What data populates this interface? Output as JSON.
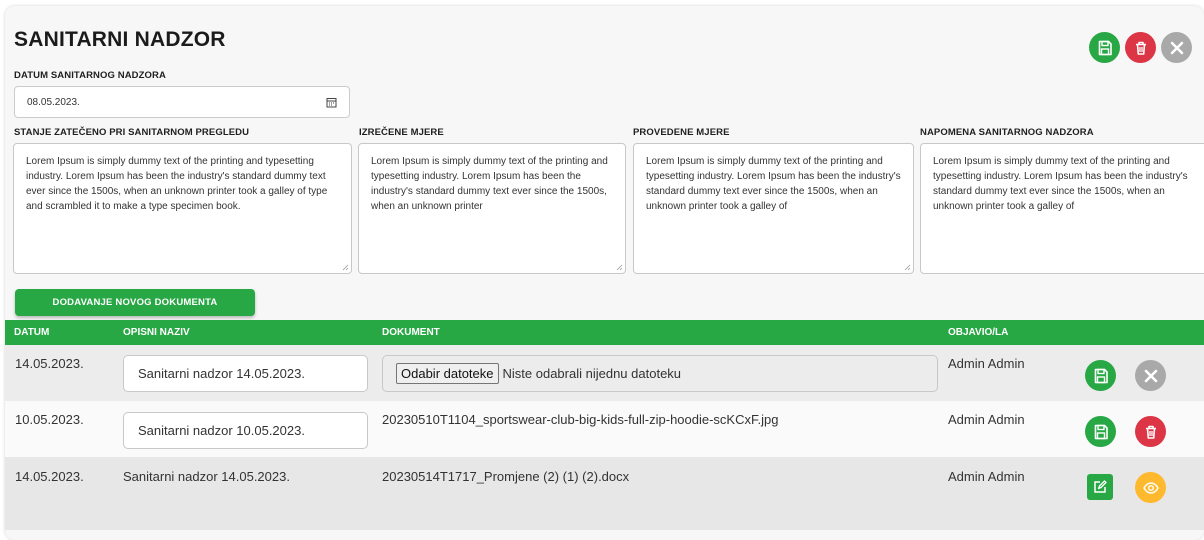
{
  "title": "SANITARNI NADZOR",
  "date_section": {
    "label": "DATUM SANITARNOG NADZORA",
    "value": "08.05.2023."
  },
  "fields": [
    {
      "label": "STANJE ZATEČENO PRI SANITARNOM PREGLEDU",
      "text": "Lorem Ipsum is simply dummy text of the printing and typesetting industry. Lorem Ipsum has been the industry's standard dummy text ever since the 1500s, when an unknown printer took a galley of type and scrambled it to make a type specimen book."
    },
    {
      "label": "IZREČENE MJERE",
      "text": "Lorem Ipsum is simply dummy text of the printing and typesetting industry. Lorem Ipsum has been the industry's standard dummy text ever since the 1500s, when an unknown printer"
    },
    {
      "label": "PROVEDENE MJERE",
      "text": "Lorem Ipsum is simply dummy text of the printing and typesetting industry. Lorem Ipsum has been the industry's standard dummy text ever since the 1500s, when an unknown printer took a galley of"
    },
    {
      "label": "NAPOMENA SANITARNOG NADZORA",
      "text": "Lorem Ipsum is simply dummy text of the printing and typesetting industry. Lorem Ipsum has been the industry's standard dummy text ever since the 1500s, when an unknown printer took a galley of"
    }
  ],
  "add_document_label": "DODAVANJE NOVOG DOKUMENTA",
  "table": {
    "headers": [
      "DATUM",
      "OPISNI NAZIV",
      "DOKUMENT",
      "OBJAVIO/LA"
    ],
    "rows": [
      {
        "date": "14.05.2023.",
        "name": "Sanitarni nadzor 14.05.2023.",
        "file_button": "Odabir datoteke",
        "file_status": "Niste odabrali nijednu datoteku",
        "author": "Admin Admin"
      },
      {
        "date": "10.05.2023.",
        "name": "Sanitarni nadzor 10.05.2023.",
        "document": "20230510T1104_sportswear-club-big-kids-full-zip-hoodie-scKCxF.jpg",
        "author": "Admin Admin"
      },
      {
        "date": "14.05.2023.",
        "name": "Sanitarni nadzor 14.05.2023.",
        "document": "20230514T1717_Promjene (2) (1) (2).docx",
        "author": "Admin Admin"
      }
    ]
  },
  "icons": {
    "save": "floppy-disk-icon",
    "delete": "trash-icon",
    "close": "x-icon",
    "calendar": "calendar-icon",
    "edit": "edit-icon",
    "view": "eye-icon"
  },
  "colors": {
    "green": "#28a745",
    "red": "#dc3545",
    "gray": "#a9a9a9",
    "orange": "#ffb92e"
  }
}
